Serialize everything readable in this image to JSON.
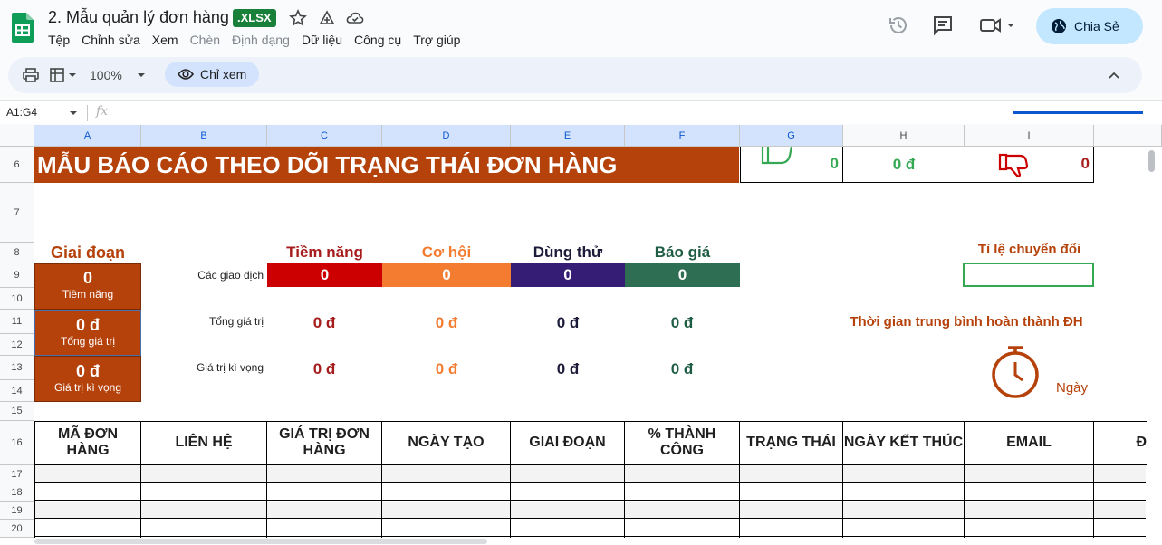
{
  "app": {
    "doc_title": "2. Mẫu quản lý đơn hàng",
    "file_badge": ".XLSX",
    "share_label": "Chia Sẻ"
  },
  "menu": [
    "Tệp",
    "Chỉnh sửa",
    "Xem",
    "Chèn",
    "Định dạng",
    "Dữ liệu",
    "Công cụ",
    "Trợ giúp"
  ],
  "menu_disabled": [
    "Chèn",
    "Định dạng"
  ],
  "toolbar": {
    "zoom": "100%",
    "view_only": "Chỉ xem"
  },
  "formula_bar": {
    "name_box": "A1:G4",
    "fx": "fx"
  },
  "columns": [
    "A",
    "B",
    "C",
    "D",
    "E",
    "F",
    "G",
    "H",
    "I"
  ],
  "rows": [
    "6",
    "7",
    "8",
    "9",
    "10",
    "11",
    "12",
    "13",
    "14",
    "15",
    "16",
    "17",
    "18",
    "19",
    "20"
  ],
  "sheet": {
    "banner": "MẪU BÁO CÁO THEO DÕI TRẠNG THÁI ĐƠN HÀNG",
    "g6_value": "0",
    "h6_value": "0 đ",
    "i6_value": "0",
    "stage_title": "Giai đoạn",
    "stage_boxes": [
      {
        "value": "0",
        "label": "Tiềm năng"
      },
      {
        "value": "0 đ",
        "label": "Tổng giá trị"
      },
      {
        "value": "0 đ",
        "label": "Giá trị kì vọng"
      }
    ],
    "stages": [
      {
        "name": "Tiềm năng",
        "color": "#cc0000",
        "text_color": "#a61c1c"
      },
      {
        "name": "Cơ hội",
        "color": "#f47c30",
        "text_color": "#f47c30"
      },
      {
        "name": "Dùng thử",
        "color": "#351c75",
        "text_color": "#1c1c3a"
      },
      {
        "name": "Báo giá",
        "color": "#2e6e52",
        "text_color": "#1f5c44"
      }
    ],
    "row_labels": {
      "transactions": "Các giao dịch",
      "total_value": "Tổng giá trị",
      "expected_value": "Giá trị kì vọng"
    },
    "transactions": [
      "0",
      "0",
      "0",
      "0"
    ],
    "total_values": [
      "0 đ",
      "0 đ",
      "0 đ",
      "0 đ"
    ],
    "expected_values": [
      "0 đ",
      "0 đ",
      "0 đ",
      "0 đ"
    ],
    "conversion_title": "Tỉ lệ chuyển đổi",
    "avg_time_title": "Thời gian trung bình hoàn thành ĐH",
    "days_label": "Ngày",
    "table_headers": [
      "MÃ ĐƠN HÀNG",
      "LIÊN HỆ",
      "GIÁ TRỊ ĐƠN HÀNG",
      "NGÀY TẠO",
      "GIAI ĐOẠN",
      "% THÀNH CÔNG",
      "TRẠNG THÁI",
      "NGÀY KẾT THÚC",
      "EMAIL",
      "Đ"
    ]
  }
}
